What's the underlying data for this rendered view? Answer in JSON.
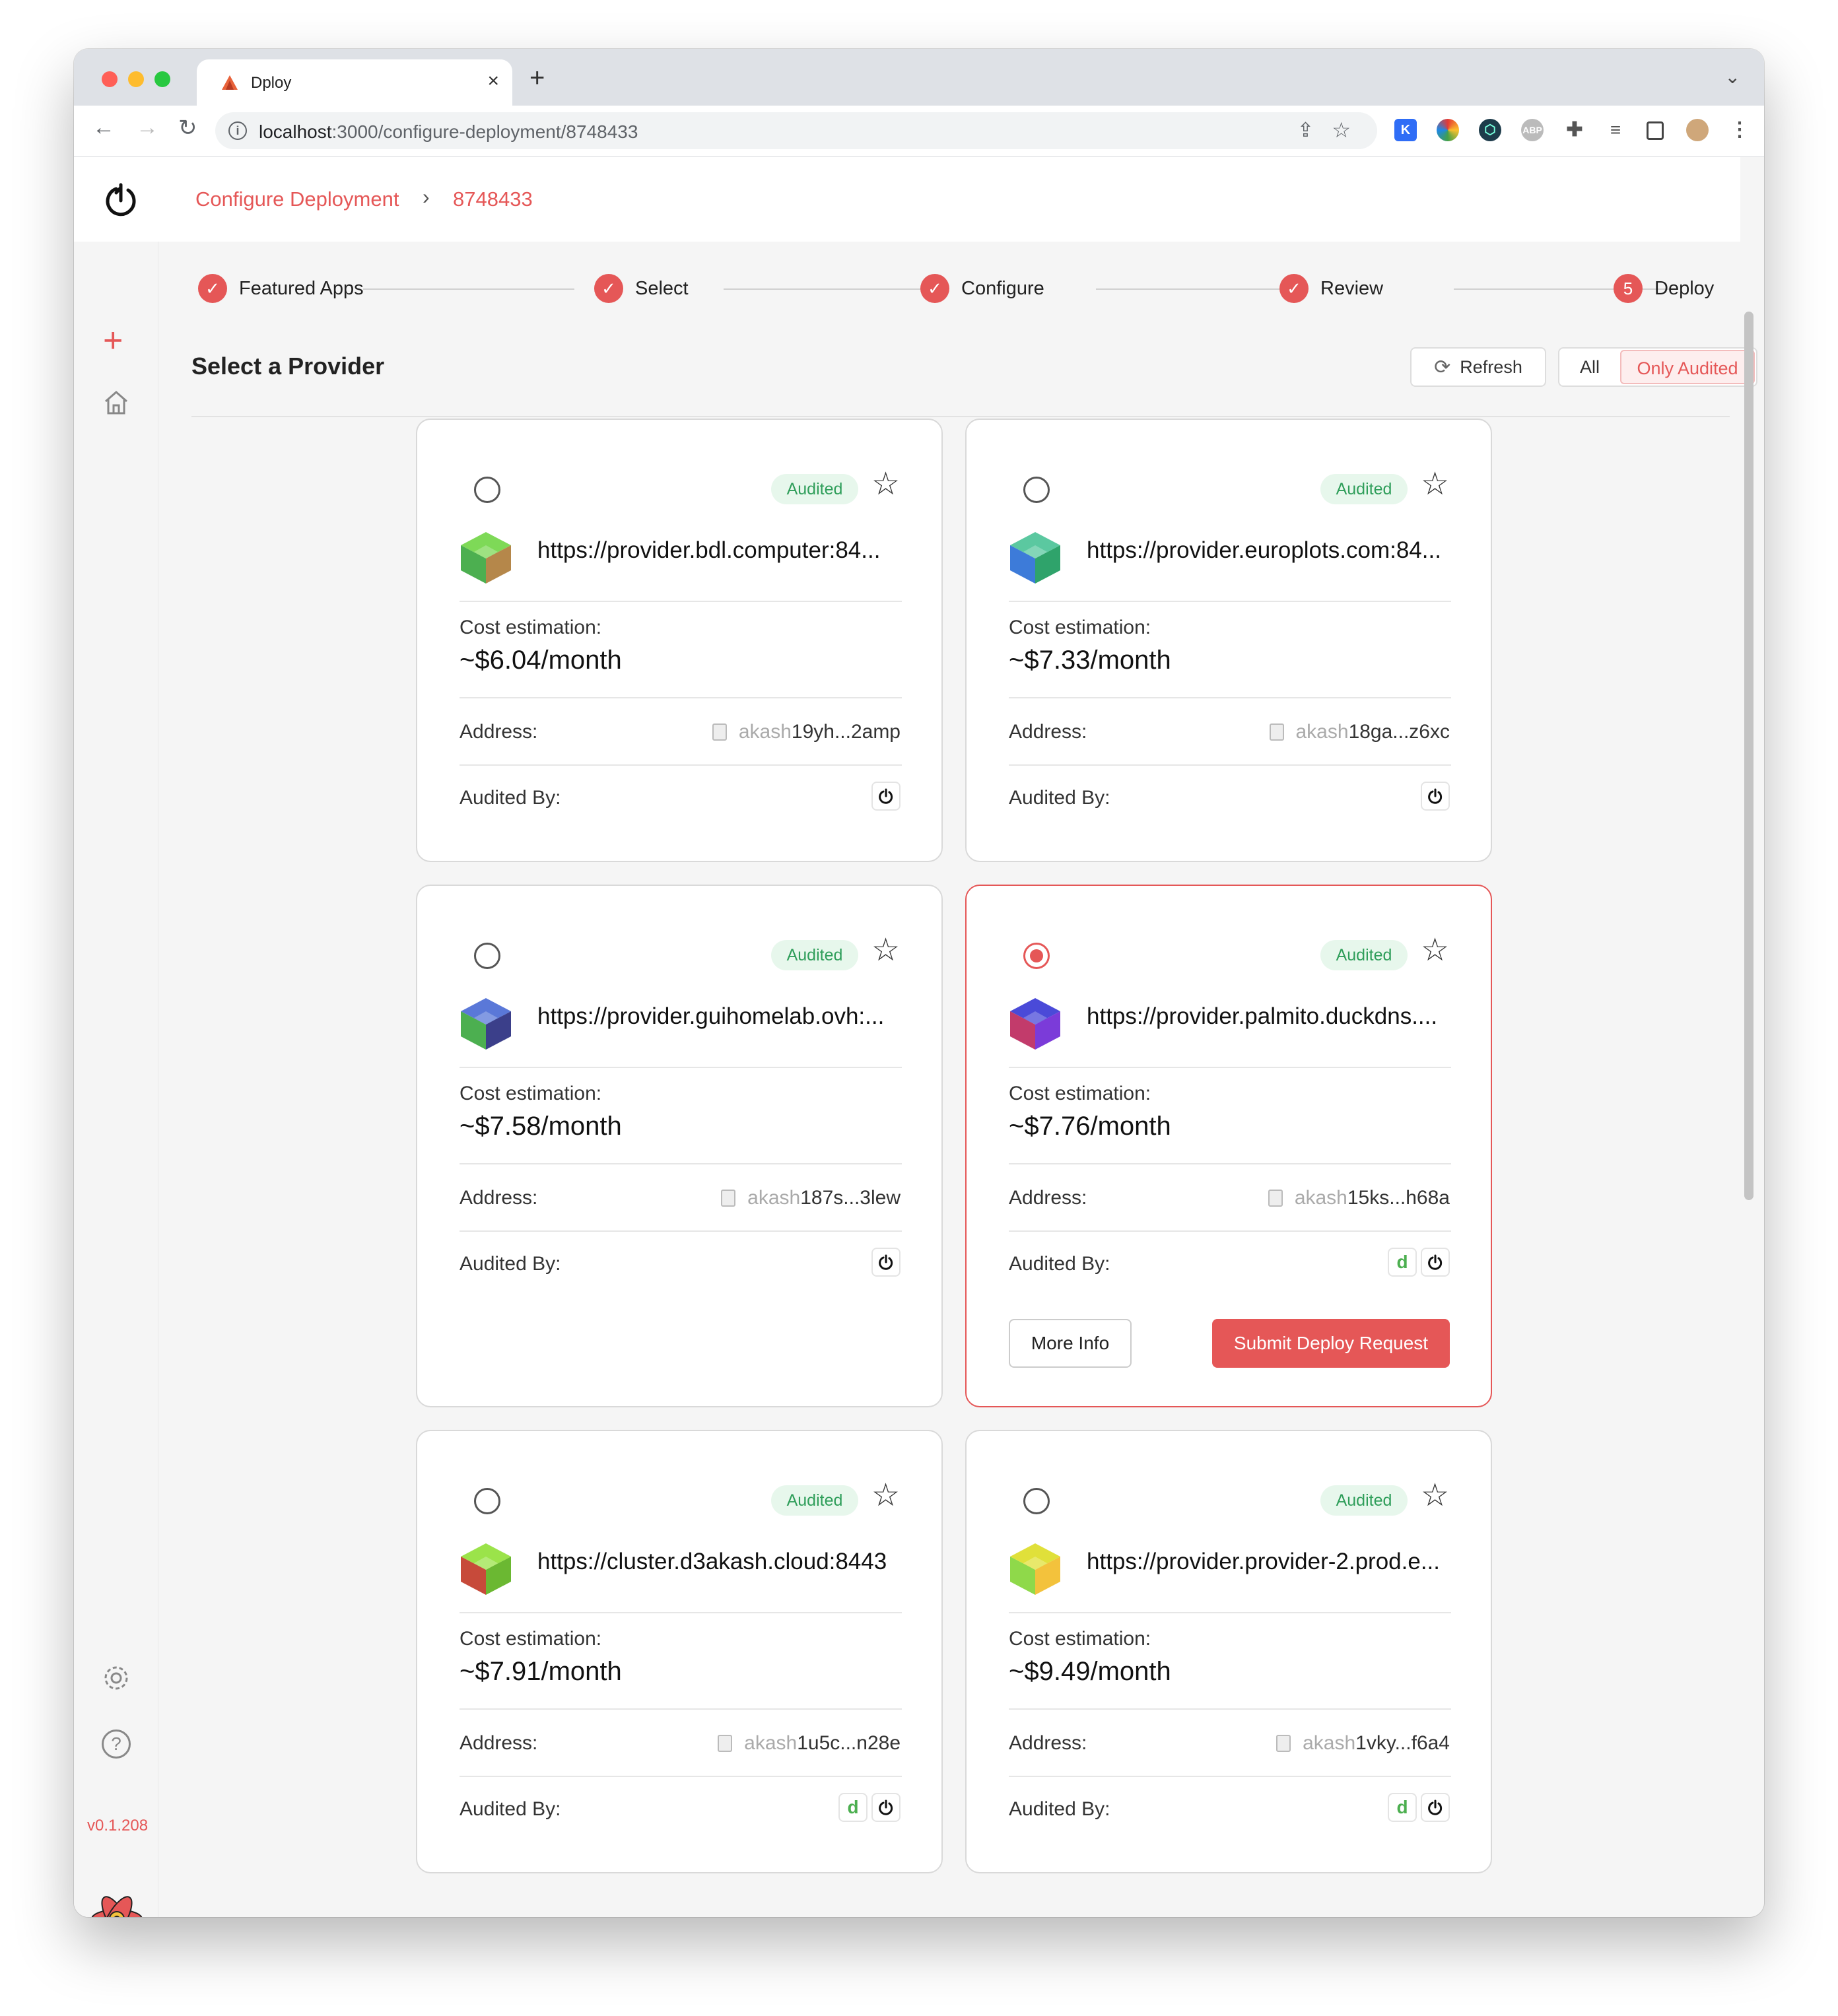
{
  "browser": {
    "tab_title": "Dploy",
    "new_tab": "+",
    "tab_close": "×",
    "url_host": "localhost",
    "url_path": ":3000/configure-deployment/8748433"
  },
  "header": {
    "breadcrumb": [
      "Configure Deployment",
      "8748433"
    ]
  },
  "sidebar": {
    "add": "+",
    "version": "v0.1.208"
  },
  "stepper": [
    {
      "label": "Featured Apps",
      "done": true
    },
    {
      "label": "Select",
      "done": true
    },
    {
      "label": "Configure",
      "done": true
    },
    {
      "label": "Review",
      "done": true
    },
    {
      "label": "Deploy",
      "done": false,
      "number": "5"
    }
  ],
  "page": {
    "title": "Select a Provider",
    "refresh_label": "Refresh",
    "filter_all": "All",
    "filter_audited": "Only Audited"
  },
  "card_labels": {
    "badge": "Audited",
    "cost_label": "Cost estimation:",
    "address_label": "Address:",
    "audited_by_label": "Audited By:",
    "more_info": "More Info",
    "submit": "Submit Deploy Request"
  },
  "providers": [
    {
      "url": "https://provider.bdl.computer:84...",
      "cost": "~$6.04/month",
      "addr_prefix": "akash",
      "addr_rest": "19yh...2amp",
      "selected": false,
      "auditors": [
        "akash"
      ]
    },
    {
      "url": "https://provider.europlots.com:84...",
      "cost": "~$7.33/month",
      "addr_prefix": "akash",
      "addr_rest": "18ga...z6xc",
      "selected": false,
      "auditors": [
        "akash"
      ]
    },
    {
      "url": "https://provider.guihomelab.ovh:...",
      "cost": "~$7.58/month",
      "addr_prefix": "akash",
      "addr_rest": "187s...3lew",
      "selected": false,
      "auditors": [
        "akash"
      ]
    },
    {
      "url": "https://provider.palmito.duckdns....",
      "cost": "~$7.76/month",
      "addr_prefix": "akash",
      "addr_rest": "15ks...h68a",
      "selected": true,
      "auditors": [
        "d",
        "akash"
      ]
    },
    {
      "url": "https://cluster.d3akash.cloud:8443",
      "cost": "~$7.91/month",
      "addr_prefix": "akash",
      "addr_rest": "1u5c...n28e",
      "selected": false,
      "auditors": [
        "d",
        "akash"
      ]
    },
    {
      "url": "https://provider.provider-2.prod.e...",
      "cost": "~$9.49/month",
      "addr_prefix": "akash",
      "addr_rest": "1vky...f6a4",
      "selected": false,
      "auditors": [
        "d",
        "akash"
      ]
    }
  ],
  "colors": {
    "accent": "#e55757",
    "badge_bg": "#e7f7ec",
    "badge_text": "#2f9e5a"
  }
}
